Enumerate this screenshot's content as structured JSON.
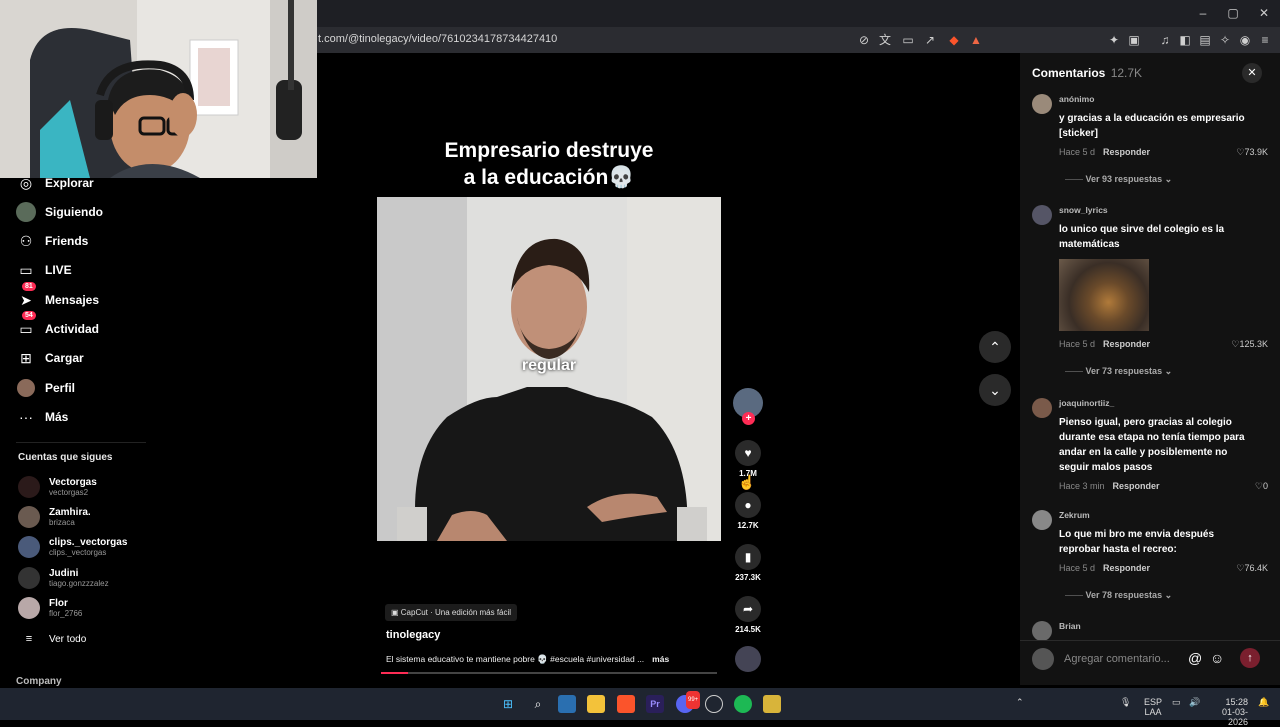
{
  "browser": {
    "url": "t.com/@tinolegacy/video/7610234178734427410",
    "controls": [
      "–",
      "▢",
      "✕"
    ]
  },
  "sidebar": {
    "items": [
      {
        "label": "Explorar",
        "icon": "compass-icon",
        "glyph": "◎"
      },
      {
        "label": "Siguiendo",
        "icon": "following-avatar-icon",
        "glyph": ""
      },
      {
        "label": "Friends",
        "icon": "friends-icon",
        "glyph": "👥"
      },
      {
        "label": "LIVE",
        "icon": "live-tv-icon",
        "glyph": "📺"
      },
      {
        "label": "Mensajes",
        "icon": "messages-icon",
        "glyph": "✈",
        "badge": "81"
      },
      {
        "label": "Actividad",
        "icon": "activity-icon",
        "glyph": "▭",
        "badge": "54"
      },
      {
        "label": "Cargar",
        "icon": "upload-icon",
        "glyph": "⊞"
      },
      {
        "label": "Perfil",
        "icon": "profile-avatar-icon",
        "glyph": ""
      },
      {
        "label": "Más",
        "icon": "more-icon",
        "glyph": "···"
      }
    ],
    "following_title": "Cuentas que sigues",
    "following": [
      {
        "name": "Vectorgas",
        "handle": "vectorgas2"
      },
      {
        "name": "Zamhira.",
        "handle": "brizaca"
      },
      {
        "name": "clips._vectorgas",
        "handle": "clips._vectorgas"
      },
      {
        "name": "Judini",
        "handle": "tiago.gonzzzalez"
      },
      {
        "name": "Flor",
        "handle": "flor_2766"
      }
    ],
    "see_all": "Ver todo",
    "company": "Company"
  },
  "video": {
    "title_line1": "Empresario destruye",
    "title_line2": "a la educación💀",
    "overlay_caption": "regular",
    "capcut": "CapCut · Una edición más fácil",
    "author": "tinolegacy",
    "description": "El sistema educativo te mantiene pobre 💀 #escuela #universidad ...",
    "more": "más",
    "progress": 0.08
  },
  "actions": {
    "likes": "1.7M",
    "comments": "12.7K",
    "saves": "237.3K",
    "shares": "214.5K"
  },
  "comments_panel": {
    "title": "Comentarios",
    "count": "12.7K",
    "close": "✕",
    "items": [
      {
        "user": "anónimo",
        "text": "y gracias a la educación es empresario [sticker]",
        "time": "Hace 5 d",
        "reply": "Responder",
        "likes": "73.9K",
        "replies": "Ver 93 respuestas"
      },
      {
        "user": "snow_lyrics",
        "text": "lo unico que sirve del colegio es la matemáticas",
        "time": "Hace 5 d",
        "reply": "Responder",
        "likes": "125.3K",
        "replies": "Ver 73 respuestas"
      },
      {
        "user": "joaquinortiiz_",
        "text": "Pienso igual, pero gracias al colegio durante esa etapa no tenía tiempo para andar en la calle y posiblemente no seguir malos pasos",
        "time": "Hace 3 min",
        "reply": "Responder",
        "likes": "0"
      },
      {
        "user": "Zekrum",
        "text": "Lo que mi bro me envia después reprobar hasta el recreo:",
        "time": "Hace 5 d",
        "reply": "Responder",
        "likes": "76.4K",
        "replies": "Ver 78 respuestas"
      },
      {
        "user": "Brian"
      }
    ],
    "input_placeholder": "Agregar comentario..."
  },
  "taskbar": {
    "lang": "ESP",
    "lang2": "LAA",
    "time": "15:28",
    "date": "01-03-2026",
    "discord_badge": "99+"
  },
  "colors": {
    "accent": "#fe2c55",
    "panel": "#121212",
    "taskbar": "#1f2530"
  }
}
